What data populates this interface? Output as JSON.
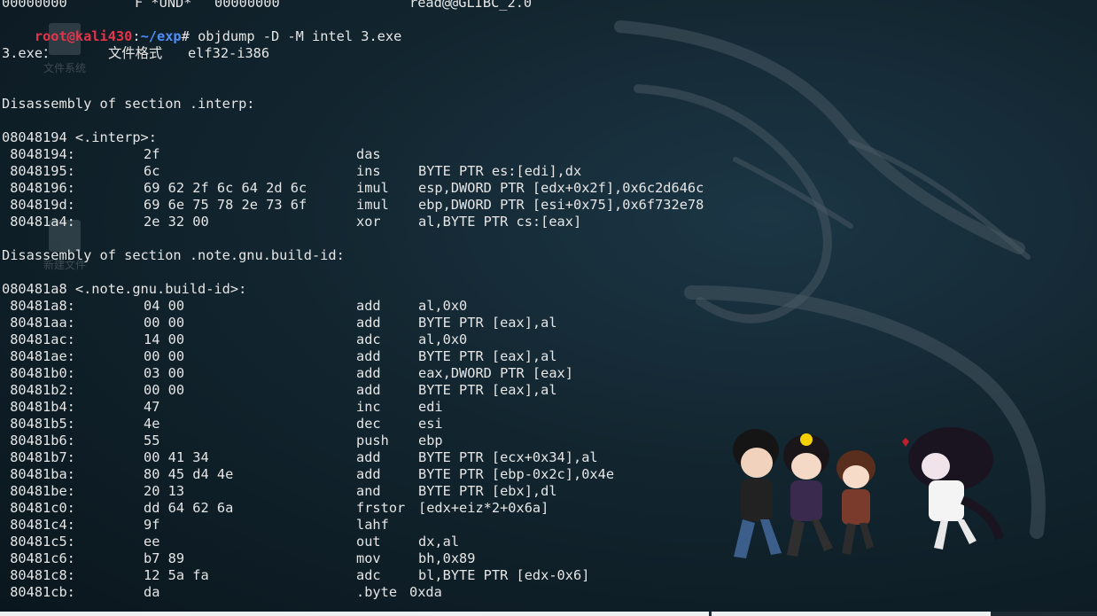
{
  "desktop": {
    "icons": [
      {
        "label": "文件系统",
        "glyph": "drive-icon"
      },
      {
        "label": "新建文件",
        "glyph": "file-icon"
      }
    ]
  },
  "terminal": {
    "top_partial": {
      "addr": "00000000",
      "flag": "F *UND*",
      "size": "00000000",
      "sym": "read@@GLIBC_2.0"
    },
    "prompt": {
      "user_host": "root@kali430",
      "sep": ":",
      "path": "~/exp",
      "symbol": "#",
      "command": " objdump -D -M intel 3.exe"
    },
    "file_line": {
      "name": "3.exe：",
      "label": "文件格式",
      "format": "elf32-i386"
    },
    "sections": [
      {
        "header": "Disassembly of section .interp:",
        "symbol": "08048194 <.interp>:",
        "rows": [
          {
            "addr": " 8048194:",
            "bytes": "2f",
            "mnem": "das",
            "ops": ""
          },
          {
            "addr": " 8048195:",
            "bytes": "6c",
            "mnem": "ins",
            "ops": "BYTE PTR es:[edi],dx"
          },
          {
            "addr": " 8048196:",
            "bytes": "69 62 2f 6c 64 2d 6c",
            "mnem": "imul",
            "ops": "esp,DWORD PTR [edx+0x2f],0x6c2d646c"
          },
          {
            "addr": " 804819d:",
            "bytes": "69 6e 75 78 2e 73 6f",
            "mnem": "imul",
            "ops": "ebp,DWORD PTR [esi+0x75],0x6f732e78"
          },
          {
            "addr": " 80481a4:",
            "bytes": "2e 32 00",
            "mnem": "xor",
            "ops": "al,BYTE PTR cs:[eax]"
          }
        ]
      },
      {
        "header": "Disassembly of section .note.gnu.build-id:",
        "symbol": "080481a8 <.note.gnu.build-id>:",
        "rows": [
          {
            "addr": " 80481a8:",
            "bytes": "04 00",
            "mnem": "add",
            "ops": "al,0x0"
          },
          {
            "addr": " 80481aa:",
            "bytes": "00 00",
            "mnem": "add",
            "ops": "BYTE PTR [eax],al"
          },
          {
            "addr": " 80481ac:",
            "bytes": "14 00",
            "mnem": "adc",
            "ops": "al,0x0"
          },
          {
            "addr": " 80481ae:",
            "bytes": "00 00",
            "mnem": "add",
            "ops": "BYTE PTR [eax],al"
          },
          {
            "addr": " 80481b0:",
            "bytes": "03 00",
            "mnem": "add",
            "ops": "eax,DWORD PTR [eax]"
          },
          {
            "addr": " 80481b2:",
            "bytes": "00 00",
            "mnem": "add",
            "ops": "BYTE PTR [eax],al"
          },
          {
            "addr": " 80481b4:",
            "bytes": "47",
            "mnem": "inc",
            "ops": "edi"
          },
          {
            "addr": " 80481b5:",
            "bytes": "4e",
            "mnem": "dec",
            "ops": "esi"
          },
          {
            "addr": " 80481b6:",
            "bytes": "55",
            "mnem": "push",
            "ops": "ebp"
          },
          {
            "addr": " 80481b7:",
            "bytes": "00 41 34",
            "mnem": "add",
            "ops": "BYTE PTR [ecx+0x34],al"
          },
          {
            "addr": " 80481ba:",
            "bytes": "80 45 d4 4e",
            "mnem": "add",
            "ops": "BYTE PTR [ebp-0x2c],0x4e"
          },
          {
            "addr": " 80481be:",
            "bytes": "20 13",
            "mnem": "and",
            "ops": "BYTE PTR [ebx],dl"
          },
          {
            "addr": " 80481c0:",
            "bytes": "dd 64 62 6a",
            "mnem": "frstor",
            "ops": "[edx+eiz*2+0x6a]"
          },
          {
            "addr": " 80481c4:",
            "bytes": "9f",
            "mnem": "lahf",
            "ops": ""
          },
          {
            "addr": " 80481c5:",
            "bytes": "ee",
            "mnem": "out",
            "ops": "dx,al"
          },
          {
            "addr": " 80481c6:",
            "bytes": "b7 89",
            "mnem": "mov",
            "ops": "bh,0x89"
          },
          {
            "addr": " 80481c8:",
            "bytes": "12 5a fa",
            "mnem": "adc",
            "ops": "bl,BYTE PTR [edx-0x6]"
          },
          {
            "addr": " 80481cb:",
            "bytes": "da",
            "mnem": ".byte",
            "ops": "0xda"
          }
        ]
      }
    ]
  },
  "colors": {
    "background": "#0b1922",
    "text": "#e6e6e6",
    "prompt_user": "#e3354a",
    "prompt_path": "#4f8ef7"
  }
}
